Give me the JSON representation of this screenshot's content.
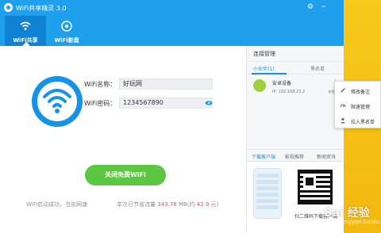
{
  "app": {
    "title": "WiFi共享精灵 3.0"
  },
  "nav": {
    "tabs": [
      {
        "label": "WiFi共享"
      },
      {
        "label": "WiFi影盘"
      }
    ]
  },
  "form": {
    "name_label": "WiFi名称：",
    "name_value": "好玩网",
    "pwd_label": "WiFi密码：",
    "pwd_value": "1234567890"
  },
  "main_button": {
    "label": "关闭免费WiFi"
  },
  "status": {
    "left": "WiFi启动成功，当前网速",
    "prefix": "本次已节省流量",
    "saved": "343.78",
    "unit": "MB(约",
    "money": "42.9",
    "suffix": "元)"
  },
  "right": {
    "header": "连接管理",
    "tab_active": "小伙伴(1)",
    "tab_other": "黑名单",
    "device": {
      "name": "安卓设备",
      "ip": "IP: 192.168.23.2",
      "limit": "不限"
    },
    "ad_tabs": [
      "下载客户端",
      "影视推荐",
      "新闻资讯"
    ],
    "qr_caption": "扫二维码下载客户端"
  },
  "popup": {
    "items": [
      "修改备注",
      "限速管理",
      "拉入黑名单"
    ]
  },
  "watermark": {
    "text": "Bai 经验",
    "sub": "jingyan.baidu.com"
  },
  "colors": {
    "brand": "#1ea0ec",
    "green": "#5cc842",
    "highlight": "#e84c6a"
  }
}
